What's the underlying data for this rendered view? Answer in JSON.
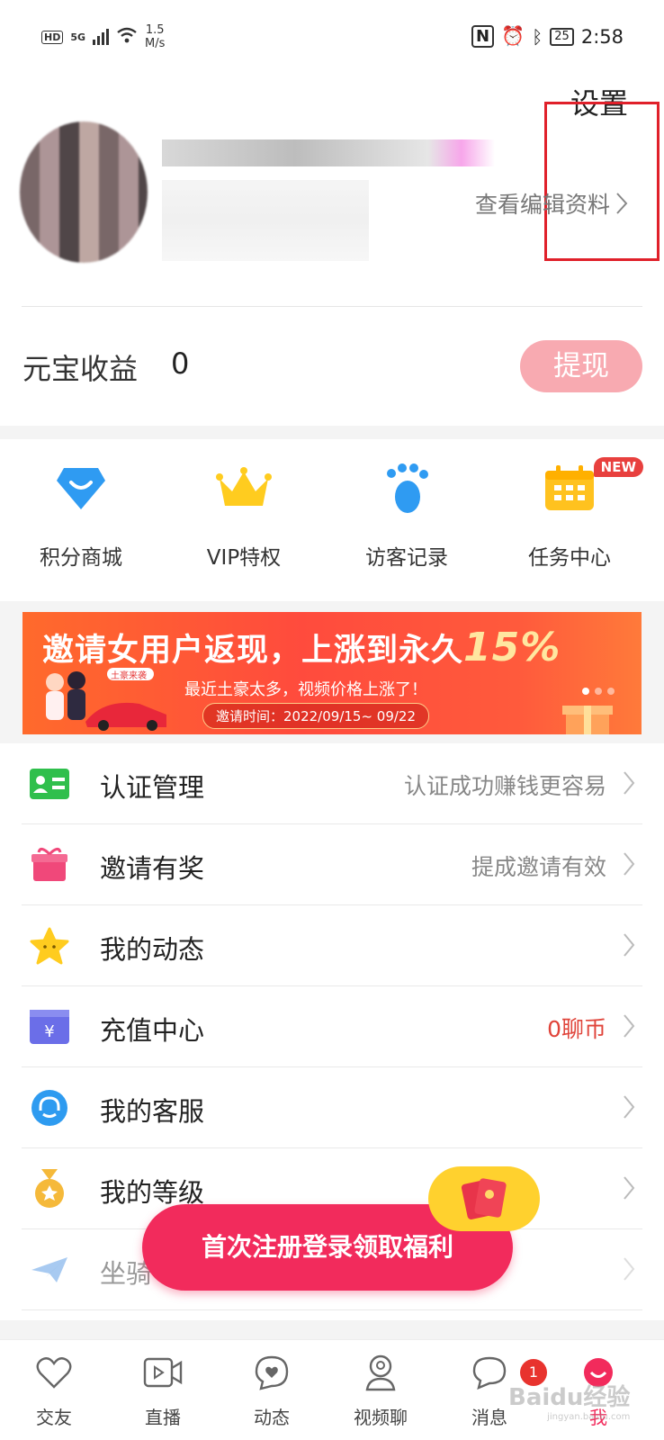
{
  "status_bar": {
    "hd": "HD",
    "network": "5G",
    "speed_value": "1.5",
    "speed_unit": "M/s",
    "battery": "25",
    "time": "2:58"
  },
  "header": {
    "settings_label": "设置",
    "edit_profile_label": "查看编辑资料",
    "earnings_label": "元宝收益",
    "earnings_value": "0",
    "withdraw_label": "提现"
  },
  "quick_actions": [
    {
      "label": "积分商城",
      "icon": "diamond-icon"
    },
    {
      "label": "VIP特权",
      "icon": "crown-icon"
    },
    {
      "label": "访客记录",
      "icon": "footprint-icon"
    },
    {
      "label": "任务中心",
      "icon": "calendar-icon",
      "badge": "NEW"
    }
  ],
  "banner": {
    "title": "邀请女用户返现，上涨到永久",
    "title_highlight": "15%",
    "subtitle": "最近土豪太多，视频价格上涨了！",
    "time_text": "邀请时间：2022/09/15~ 09/22",
    "art_label": "土豪来袭"
  },
  "menu": [
    {
      "label": "认证管理",
      "hint": "认证成功赚钱更容易",
      "icon": "id-card-icon",
      "color": "#2fbf4c"
    },
    {
      "label": "邀请有奖",
      "hint": "提成邀请有效",
      "icon": "gift-icon",
      "color": "#f0487a"
    },
    {
      "label": "我的动态",
      "hint": "",
      "icon": "star-icon",
      "color": "#ffcc1f"
    },
    {
      "label": "充值中心",
      "hint": "0聊币",
      "icon": "wallet-icon",
      "color": "#6b6ee8"
    },
    {
      "label": "我的客服",
      "hint": "",
      "icon": "headset-icon",
      "color": "#2e9bf0"
    },
    {
      "label": "我的等级",
      "hint": "",
      "icon": "medal-icon",
      "color": "#f5b93a"
    },
    {
      "label": "坐骑",
      "hint": "",
      "icon": "plane-icon",
      "color": "#6fa8e8"
    }
  ],
  "promo": {
    "label": "首次注册登录领取福利"
  },
  "bottom_nav": [
    {
      "label": "交友",
      "icon": "heart-icon"
    },
    {
      "label": "直播",
      "icon": "video-icon"
    },
    {
      "label": "动态",
      "icon": "chat-heart-icon"
    },
    {
      "label": "视频聊",
      "icon": "person-icon"
    },
    {
      "label": "消息",
      "icon": "message-icon",
      "badge": "1"
    },
    {
      "label": "我",
      "icon": "me-icon",
      "active": true
    }
  ],
  "watermark": {
    "text": "Baidu经验",
    "sub": "jingyan.baidu.com"
  },
  "colors": {
    "accent": "#f22b5c",
    "withdraw": "#f8aab1",
    "highlight_box": "#e0202a"
  }
}
